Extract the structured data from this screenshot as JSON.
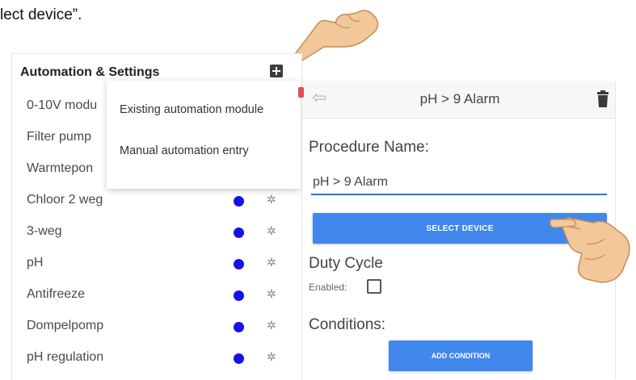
{
  "document": {
    "fragment_text": "lect device”."
  },
  "left_panel": {
    "title": "Automation & Settings",
    "items": [
      {
        "label": "0-10V modu"
      },
      {
        "label": "Filter pump"
      },
      {
        "label": "Warmtepon"
      },
      {
        "label": "Chloor 2 weg"
      },
      {
        "label": "3-weg"
      },
      {
        "label": "pH"
      },
      {
        "label": "Antifreeze"
      },
      {
        "label": "Dompelpomp"
      },
      {
        "label": "pH regulation"
      }
    ]
  },
  "dropdown": {
    "items": [
      {
        "label": "Existing automation module"
      },
      {
        "label": "Manual automation entry"
      }
    ]
  },
  "right_panel": {
    "header_title": "pH > 9 Alarm",
    "procedure_label": "Procedure Name:",
    "procedure_value": "pH > 9 Alarm",
    "select_device_label": "SELECT DEVICE",
    "duty_cycle_label": "Duty Cycle",
    "enabled_label": "Enabled:",
    "enabled_checked": false,
    "conditions_label": "Conditions:",
    "add_condition_label": "ADD CONDITION"
  },
  "icons": {
    "add": "plus-square-icon",
    "settings": "gear-icon",
    "back": "back-arrow-icon",
    "delete": "trash-icon",
    "pointer": "pointing-hand-icon",
    "status": "status-dot-icon"
  },
  "colors": {
    "status_dot": "#1414e6",
    "button": "#4187ec",
    "input_underline": "#2f6fe0"
  }
}
